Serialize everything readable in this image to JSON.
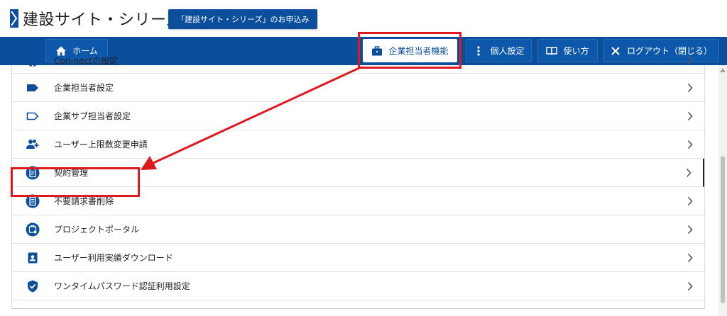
{
  "header": {
    "logo_text": "建設サイト・シリーズ",
    "apply_button": "「建設サイト・シリーズ」のお申込み"
  },
  "navbar": {
    "home": "ホーム",
    "company_admin": "企業担当者機能",
    "personal_settings": "個人設定",
    "usage": "使い方",
    "logout": "ログアウト（閉じる）"
  },
  "menu": {
    "items": [
      {
        "label": "Con-nectの設定",
        "icon": "connect-icon"
      },
      {
        "label": "企業担当者設定",
        "icon": "tag-filled-icon"
      },
      {
        "label": "企業サブ担当者設定",
        "icon": "tag-outline-icon"
      },
      {
        "label": "ユーザー上限数変更申請",
        "icon": "add-users-icon"
      },
      {
        "label": "契約管理",
        "icon": "contract-icon"
      },
      {
        "label": "不要請求書削除",
        "icon": "invoice-icon"
      },
      {
        "label": "プロジェクトポータル",
        "icon": "project-portal-icon"
      },
      {
        "label": "ユーザー利用実績ダウンロード",
        "icon": "user-badge-icon"
      },
      {
        "label": "ワンタイムパスワード認証利用設定",
        "icon": "shield-check-icon"
      }
    ]
  },
  "colors": {
    "primary": "#0b4e9c",
    "highlight": "#e0191f",
    "icon": "#0b4e9c"
  }
}
